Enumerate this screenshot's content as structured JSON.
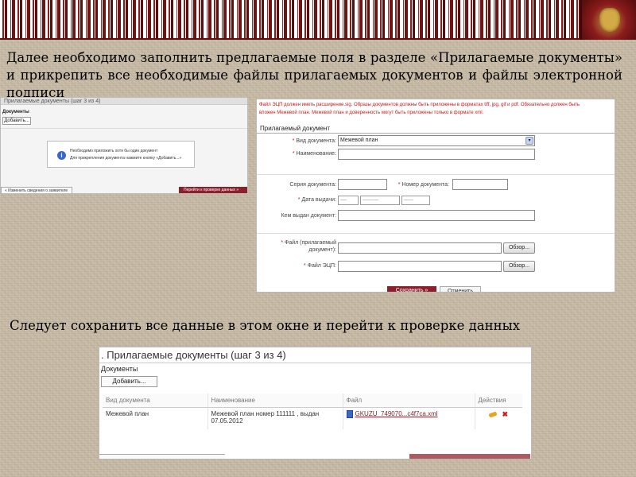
{
  "intro_text": "Далее необходимо заполнить предлагаемые поля в разделе «Прилагаемые документы» и прикрепить все необходимые файлы прилагаемых документов и файлы электронной подписи",
  "save_text": "Следует сохранить все данные в этом окне и перейти к проверке данных",
  "panel1": {
    "header": "Прилагаемые документы (шаг 3 из 4)",
    "docs_label": "Документы",
    "add_button": "Добавить...",
    "msg_icon": "i",
    "msg_line1": "Необходимо приложить хотя бы один документ",
    "msg_line2": "Для прикрепления документа нажмите кнопку «Добавить...»",
    "back_button": "« Изменить сведения о заявителе",
    "next_button": "Перейти к проверке данных »"
  },
  "panel2": {
    "notice_line1": "Файл ЭЦП должен иметь расширение.sig. Образы документов должны быть приложены в форматах tiff, jpg, gif и pdf. Обязательно должен быть",
    "notice_line2": "вложен Межевой план. Межевой план и доверенность могут быть приложены только в формате xml.",
    "section_title": "Прилагаемый документ",
    "labels": {
      "doc_type": "Вид документа:",
      "name": "Наименование:",
      "series": "Серия документа:",
      "number": "Номер документа:",
      "date": "Дата выдачи:",
      "issuer": "Кем выдан документ:",
      "file_line1": "Файл (прилагаемый",
      "file_line2": "документ):",
      "sig_file": "Файл ЭЦП:"
    },
    "star": "*",
    "doc_type_value": "Межевой план",
    "select_arrow": "▾",
    "date_day": "----",
    "date_month": "----------",
    "date_year": "------",
    "browse_button": "Обзор...",
    "save_button": "Сохранить »",
    "cancel_button": "Отменить"
  },
  "panel3": {
    "title": ". Прилагаемые документы (шаг 3 из 4)",
    "docs_label": "Документы",
    "add_button": "Добавить...",
    "columns": [
      "Вид документа",
      "Наименование",
      "Файл",
      "Действия"
    ],
    "rows": [
      {
        "doc_type": "Межевой план",
        "name": "Межевой план номер 111111 , выдан 07.05.2012",
        "file": "GKUZU_749070...c4f7ca.xml"
      }
    ],
    "delete_glyph": "✖"
  },
  "colors": {
    "brand_red": "#8c1f2a",
    "required_star": "#c81818",
    "banner_red": "#7a1a1a"
  },
  "icons": [
    "info-icon",
    "dropdown-arrow-icon",
    "xml-file-icon",
    "edit-pencil-icon",
    "delete-icon",
    "emblem-logo"
  ]
}
